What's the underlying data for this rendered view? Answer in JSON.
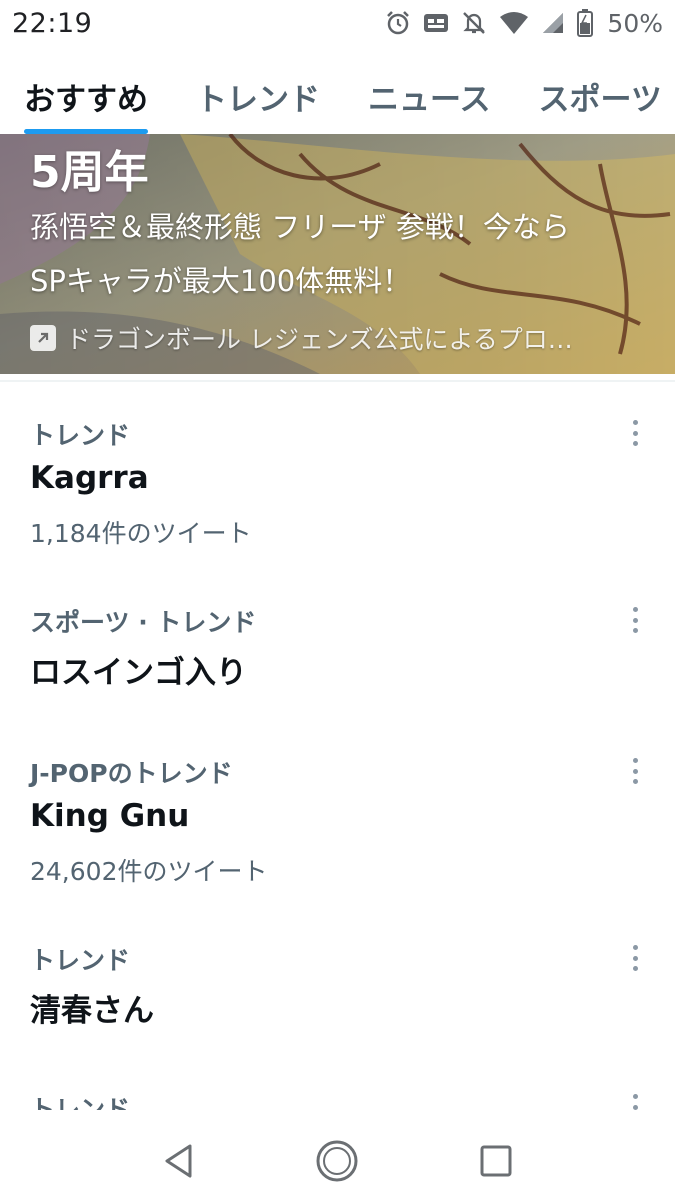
{
  "status_bar": {
    "time": "22:19",
    "battery_text": "50%",
    "icons": [
      "alarm-icon",
      "notification-badge-icon",
      "mute-icon",
      "wifi-icon",
      "signal-icon",
      "battery-icon"
    ]
  },
  "tabs": [
    {
      "label": "おすすめ",
      "active": true
    },
    {
      "label": "トレンド",
      "active": false
    },
    {
      "label": "ニュース",
      "active": false
    },
    {
      "label": "スポーツ",
      "active": false
    }
  ],
  "promo": {
    "headline": "5周年",
    "line1": "孫悟空＆最終形態 フリーザ 参戦！今なら",
    "line2": "SPキャラが最大100体無料！",
    "source": "ドラゴンボール レジェンズ公式によるプロ…",
    "source_icon": "promoted-arrow-icon"
  },
  "trends": [
    {
      "context": "トレンド",
      "title": "Kagrra",
      "count": "1,184件のツイート"
    },
    {
      "context": "スポーツ · トレンド",
      "title": "ロスインゴ入り",
      "count": ""
    },
    {
      "context": "J-POPのトレンド",
      "title": "King Gnu",
      "count": "24,602件のツイート"
    },
    {
      "context": "トレンド",
      "title": "清春さん",
      "count": ""
    },
    {
      "context": "トレンド",
      "title": "",
      "count": ""
    }
  ],
  "nav": {
    "icons": [
      "back-triangle-icon",
      "home-circle-icon",
      "recents-square-icon"
    ]
  },
  "colors": {
    "accent": "#1d9bf0",
    "text_primary": "#0f1419",
    "text_secondary": "#536471"
  }
}
